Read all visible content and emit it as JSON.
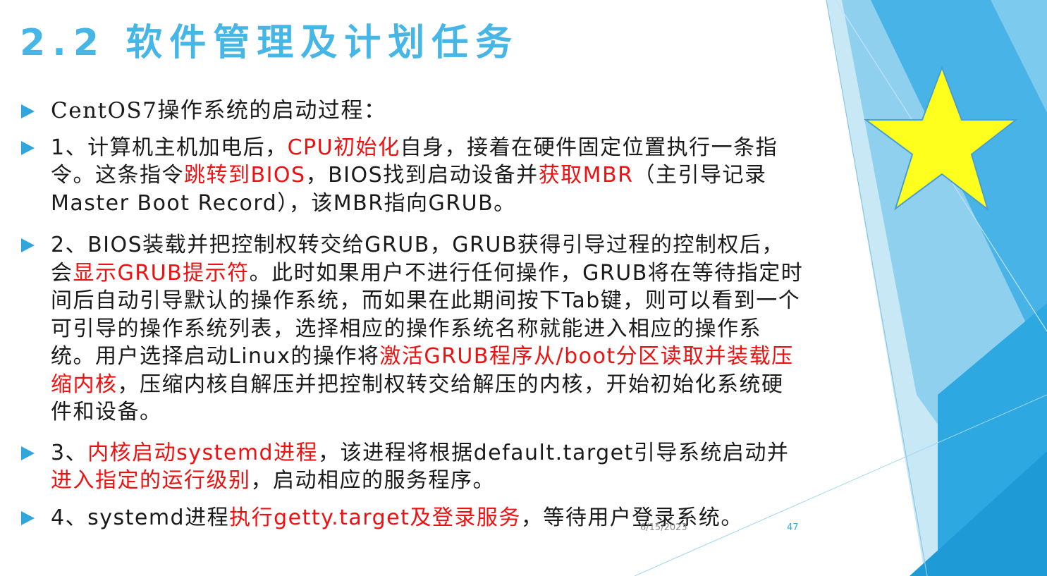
{
  "slide": {
    "title": "2.2 软件管理及计划任务",
    "bullets": [
      {
        "parts": [
          {
            "text": "CentOS7操作系统的启动过程：",
            "red": false
          }
        ]
      },
      {
        "parts": [
          {
            "text": "1、计算机主机加电后，",
            "red": false
          },
          {
            "text": "CPU初始化",
            "red": true
          },
          {
            "text": "自身，接着在硬件固定位置执行一条指令。这条指令",
            "red": false
          },
          {
            "text": "跳转到BIOS",
            "red": true
          },
          {
            "text": "，BIOS找到启动设备并",
            "red": false
          },
          {
            "text": "获取MBR",
            "red": true
          },
          {
            "text": "（主引导记录 Master Boot Record），该MBR指向GRUB。",
            "red": false
          }
        ]
      },
      {
        "parts": [
          {
            "text": "2、BIOS装载并把控制权转交给GRUB，GRUB获得引导过程的控制权后，会",
            "red": false
          },
          {
            "text": "显示GRUB提示符",
            "red": true
          },
          {
            "text": "。此时如果用户不进行任何操作，GRUB将在等待指定时间后自动引导默认的操作系统，而如果在此期间按下Tab键，则可以看到一个可引导的操作系统列表，选择相应的操作系统名称就能进入相应的操作系统。用户选择启动Linux的操作将",
            "red": false
          },
          {
            "text": "激活GRUB程序从/boot分区读取并装载压缩内核",
            "red": true
          },
          {
            "text": "，压缩内核自解压并把控制权转交给解压的内核，开始初始化系统硬件和设备。",
            "red": false
          }
        ]
      },
      {
        "parts": [
          {
            "text": "3、",
            "red": false
          },
          {
            "text": "内核启动systemd进程",
            "red": true
          },
          {
            "text": "，该进程将根据default.target引导系统启动并",
            "red": false
          },
          {
            "text": "进入指定的运行级别",
            "red": true
          },
          {
            "text": "，启动相应的服务程序。",
            "red": false
          }
        ]
      },
      {
        "parts": [
          {
            "text": "4、systemd进程",
            "red": false
          },
          {
            "text": "执行getty.target及登录服务",
            "red": true
          },
          {
            "text": "，等待用户登录系统。",
            "red": false
          }
        ]
      }
    ],
    "footer": {
      "date": "6/15/2023",
      "page": "47"
    }
  },
  "colors": {
    "title": "#45b6e6",
    "bullet_arrow": "#30a6dc",
    "body_text": "#1a1a1a",
    "highlight": "#ee1111",
    "star_fill": "#ffff1e",
    "star_stroke": "#4a9fcf"
  },
  "icons": {
    "bullet": "triangle-right-icon",
    "decoration": "star-icon"
  }
}
